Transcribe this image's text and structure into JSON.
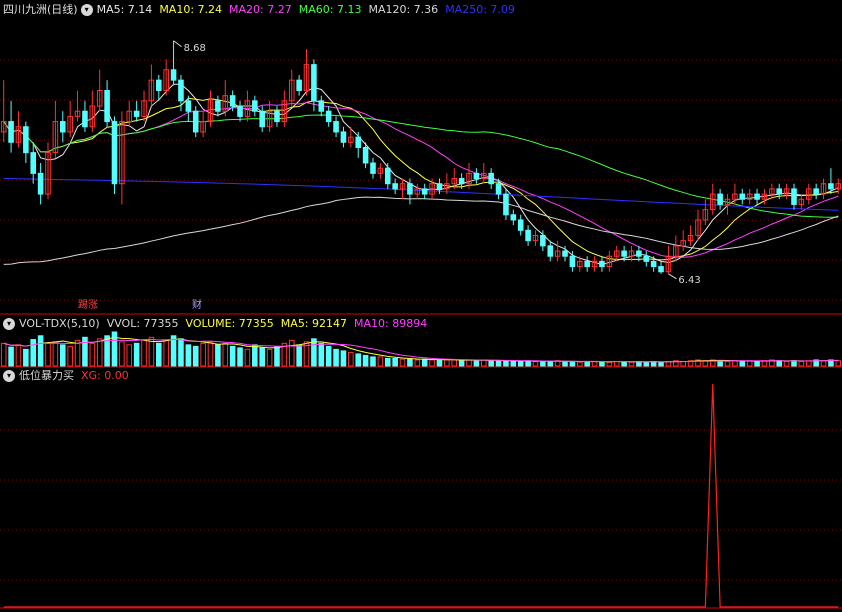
{
  "stock": {
    "name": "四川九洲(日线)"
  },
  "main_legend": [
    {
      "text": "MA5: 7.14",
      "color": "#e8e8e8"
    },
    {
      "text": "MA10: 7.24",
      "color": "#ffff40"
    },
    {
      "text": "MA20: 7.27",
      "color": "#ff40ff"
    },
    {
      "text": "MA60: 7.13",
      "color": "#40ff40"
    },
    {
      "text": "MA120: 7.36",
      "color": "#d8d8d8"
    },
    {
      "text": "MA250: 7.09",
      "color": "#3030ff"
    }
  ],
  "vol_legend": [
    {
      "text": "VOL-TDX(5,10)",
      "color": "#d8d8d8"
    },
    {
      "text": "VVOL: 77355",
      "color": "#d8d8d8"
    },
    {
      "text": "VOLUME: 77355",
      "color": "#ffff40"
    },
    {
      "text": "MA5: 92147",
      "color": "#ffff40"
    },
    {
      "text": "MA10: 89894",
      "color": "#ff40ff"
    }
  ],
  "ind_legend": [
    {
      "text": "低位暴力买",
      "color": "#d8d8d8"
    },
    {
      "text": "XG: 0.00",
      "color": "#ff3030"
    }
  ],
  "price_annotations": {
    "high": "8.68",
    "low": "6.43"
  },
  "event_tags": [
    {
      "text": "踢涨",
      "color": "#ff4040"
    },
    {
      "text": "财",
      "color": "#a0a0ff"
    }
  ],
  "colors": {
    "up": "#ff3232",
    "down": "#54ffff",
    "background": "#000000",
    "grid": "#8b0000"
  },
  "chart_data": [
    {
      "type": "candlestick",
      "panel": "price",
      "ylim": [
        6.1,
        8.9
      ],
      "high_mark": {
        "index": 23,
        "value": 8.68
      },
      "low_mark": {
        "index": 90,
        "value": 6.43
      },
      "candles": [
        [
          7.8,
          7.9,
          8.3,
          7.7
        ],
        [
          7.9,
          7.7,
          8.1,
          7.6
        ],
        [
          7.7,
          7.85,
          8.0,
          7.65
        ],
        [
          7.85,
          7.6,
          7.9,
          7.5
        ],
        [
          7.6,
          7.4,
          7.7,
          7.3
        ],
        [
          7.4,
          7.2,
          7.5,
          7.1
        ],
        [
          7.2,
          7.6,
          7.7,
          7.15
        ],
        [
          7.6,
          7.9,
          8.1,
          7.55
        ],
        [
          7.9,
          7.8,
          8.0,
          7.7
        ],
        [
          7.8,
          7.95,
          8.1,
          7.75
        ],
        [
          7.95,
          8.0,
          8.2,
          7.9
        ],
        [
          8.0,
          7.85,
          8.1,
          7.8
        ],
        [
          7.85,
          8.05,
          8.2,
          7.8
        ],
        [
          8.05,
          8.2,
          8.4,
          8.0
        ],
        [
          8.2,
          7.9,
          8.3,
          7.85
        ],
        [
          7.9,
          7.3,
          7.95,
          7.2
        ],
        [
          7.3,
          7.9,
          8.0,
          7.1
        ],
        [
          7.9,
          8.0,
          8.1,
          7.85
        ],
        [
          8.0,
          7.95,
          8.1,
          7.9
        ],
        [
          7.95,
          8.1,
          8.2,
          7.9
        ],
        [
          8.1,
          8.3,
          8.45,
          8.05
        ],
        [
          8.3,
          8.2,
          8.35,
          8.1
        ],
        [
          8.2,
          8.4,
          8.5,
          8.15
        ],
        [
          8.4,
          8.3,
          8.68,
          8.25
        ],
        [
          8.3,
          8.1,
          8.35,
          8.0
        ],
        [
          8.1,
          8.0,
          8.15,
          7.9
        ],
        [
          8.0,
          7.8,
          8.05,
          7.75
        ],
        [
          7.8,
          7.9,
          8.0,
          7.75
        ],
        [
          7.9,
          8.1,
          8.2,
          7.85
        ],
        [
          8.1,
          8.0,
          8.15,
          7.95
        ],
        [
          8.0,
          8.15,
          8.3,
          7.95
        ],
        [
          8.15,
          8.05,
          8.2,
          8.0
        ],
        [
          8.05,
          7.95,
          8.1,
          7.9
        ],
        [
          7.95,
          8.1,
          8.2,
          7.9
        ],
        [
          8.1,
          8.0,
          8.15,
          7.95
        ],
        [
          8.0,
          7.85,
          8.05,
          7.8
        ],
        [
          7.85,
          8.0,
          8.1,
          7.8
        ],
        [
          8.0,
          7.9,
          8.05,
          7.85
        ],
        [
          7.9,
          8.1,
          8.2,
          7.85
        ],
        [
          8.1,
          8.3,
          8.4,
          8.05
        ],
        [
          8.3,
          8.2,
          8.35,
          8.15
        ],
        [
          8.2,
          8.45,
          8.6,
          8.15
        ],
        [
          8.45,
          8.1,
          8.5,
          8.0
        ],
        [
          8.1,
          8.0,
          8.15,
          7.95
        ],
        [
          8.0,
          7.9,
          8.05,
          7.85
        ],
        [
          7.9,
          7.8,
          7.95,
          7.75
        ],
        [
          7.8,
          7.7,
          7.85,
          7.65
        ],
        [
          7.7,
          7.75,
          7.85,
          7.65
        ],
        [
          7.75,
          7.65,
          7.8,
          7.55
        ],
        [
          7.65,
          7.5,
          7.7,
          7.45
        ],
        [
          7.5,
          7.4,
          7.55,
          7.35
        ],
        [
          7.4,
          7.45,
          7.5,
          7.35
        ],
        [
          7.45,
          7.3,
          7.5,
          7.25
        ],
        [
          7.3,
          7.25,
          7.35,
          7.2
        ],
        [
          7.25,
          7.3,
          7.35,
          7.15
        ],
        [
          7.3,
          7.2,
          7.35,
          7.1
        ],
        [
          7.2,
          7.25,
          7.3,
          7.15
        ],
        [
          7.25,
          7.2,
          7.3,
          7.15
        ],
        [
          7.2,
          7.3,
          7.35,
          7.15
        ],
        [
          7.3,
          7.25,
          7.35,
          7.2
        ],
        [
          7.25,
          7.3,
          7.4,
          7.2
        ],
        [
          7.3,
          7.35,
          7.45,
          7.25
        ],
        [
          7.35,
          7.3,
          7.4,
          7.25
        ],
        [
          7.3,
          7.4,
          7.5,
          7.25
        ],
        [
          7.4,
          7.35,
          7.45,
          7.3
        ],
        [
          7.35,
          7.4,
          7.5,
          7.3
        ],
        [
          7.4,
          7.3,
          7.45,
          7.25
        ],
        [
          7.3,
          7.2,
          7.35,
          7.15
        ],
        [
          7.2,
          7.0,
          7.25,
          6.95
        ],
        [
          7.0,
          6.95,
          7.05,
          6.9
        ],
        [
          6.95,
          6.85,
          7.0,
          6.8
        ],
        [
          6.85,
          6.75,
          6.9,
          6.7
        ],
        [
          6.75,
          6.8,
          6.85,
          6.7
        ],
        [
          6.8,
          6.7,
          6.85,
          6.65
        ],
        [
          6.7,
          6.6,
          6.75,
          6.55
        ],
        [
          6.6,
          6.65,
          6.75,
          6.55
        ],
        [
          6.65,
          6.6,
          6.7,
          6.55
        ],
        [
          6.6,
          6.5,
          6.65,
          6.45
        ],
        [
          6.5,
          6.55,
          6.6,
          6.45
        ],
        [
          6.55,
          6.5,
          6.6,
          6.45
        ],
        [
          6.5,
          6.55,
          6.6,
          6.45
        ],
        [
          6.55,
          6.5,
          6.6,
          6.45
        ],
        [
          6.5,
          6.6,
          6.65,
          6.45
        ],
        [
          6.6,
          6.65,
          6.7,
          6.55
        ],
        [
          6.65,
          6.6,
          6.7,
          6.55
        ],
        [
          6.6,
          6.65,
          6.7,
          6.55
        ],
        [
          6.65,
          6.6,
          6.7,
          6.55
        ],
        [
          6.6,
          6.55,
          6.65,
          6.5
        ],
        [
          6.55,
          6.5,
          6.6,
          6.45
        ],
        [
          6.5,
          6.45,
          6.55,
          6.43
        ],
        [
          6.45,
          6.6,
          6.7,
          6.43
        ],
        [
          6.6,
          6.7,
          6.8,
          6.55
        ],
        [
          6.7,
          6.75,
          6.85,
          6.65
        ],
        [
          6.75,
          6.8,
          6.9,
          6.7
        ],
        [
          6.8,
          6.95,
          7.05,
          6.75
        ],
        [
          6.95,
          7.05,
          7.15,
          6.9
        ],
        [
          7.05,
          7.2,
          7.3,
          7.0
        ],
        [
          7.2,
          7.1,
          7.25,
          7.05
        ],
        [
          7.1,
          7.15,
          7.2,
          7.0
        ],
        [
          7.15,
          7.2,
          7.3,
          7.1
        ],
        [
          7.2,
          7.15,
          7.25,
          7.1
        ],
        [
          7.15,
          7.2,
          7.25,
          7.1
        ],
        [
          7.2,
          7.15,
          7.25,
          7.1
        ],
        [
          7.15,
          7.2,
          7.25,
          7.1
        ],
        [
          7.2,
          7.25,
          7.3,
          7.15
        ],
        [
          7.25,
          7.2,
          7.3,
          7.15
        ],
        [
          7.2,
          7.25,
          7.3,
          7.15
        ],
        [
          7.25,
          7.1,
          7.3,
          7.05
        ],
        [
          7.1,
          7.15,
          7.2,
          7.05
        ],
        [
          7.15,
          7.25,
          7.3,
          7.1
        ],
        [
          7.25,
          7.2,
          7.3,
          7.15
        ],
        [
          7.2,
          7.3,
          7.35,
          7.15
        ],
        [
          7.3,
          7.25,
          7.45,
          7.2
        ],
        [
          7.25,
          7.3,
          7.35,
          7.2
        ]
      ]
    },
    {
      "type": "bar",
      "panel": "volume",
      "values": [
        30,
        25,
        28,
        22,
        35,
        40,
        30,
        32,
        28,
        26,
        34,
        38,
        30,
        36,
        40,
        45,
        32,
        28,
        30,
        35,
        38,
        30,
        34,
        40,
        36,
        28,
        26,
        30,
        32,
        28,
        30,
        26,
        24,
        22,
        28,
        24,
        22,
        26,
        30,
        34,
        28,
        32,
        36,
        30,
        26,
        22,
        20,
        18,
        16,
        14,
        12,
        12,
        10,
        10,
        9,
        9,
        8,
        9,
        8,
        8,
        8,
        8,
        7,
        8,
        7,
        8,
        7,
        7,
        6,
        7,
        6,
        7,
        6,
        6,
        6,
        7,
        6,
        6,
        5,
        6,
        6,
        6,
        5,
        6,
        6,
        5,
        6,
        5,
        6,
        5,
        6,
        7,
        6,
        7,
        8,
        7,
        8,
        7,
        6,
        7,
        6,
        7,
        6,
        7,
        8,
        7,
        6,
        7,
        6,
        7,
        8,
        7,
        8,
        7
      ]
    },
    {
      "type": "line",
      "panel": "indicator",
      "spike_index": 96,
      "spike_value": 1
    }
  ]
}
